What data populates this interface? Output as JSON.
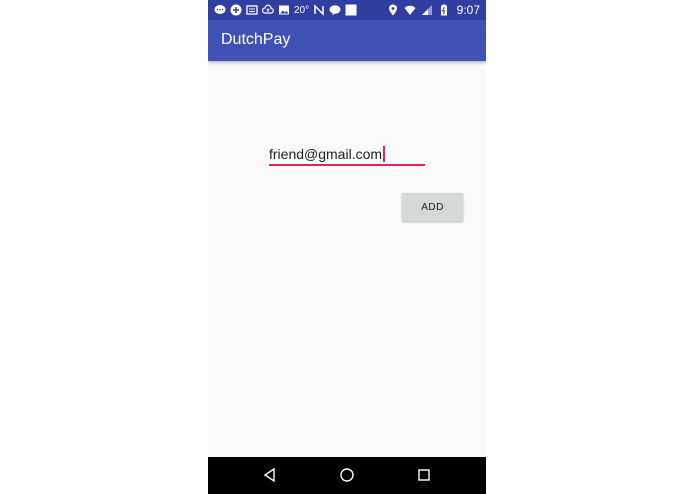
{
  "status_bar": {
    "temperature": "20°",
    "time": "9:07",
    "background": "#303f9f",
    "icons_left": [
      "chat-icon",
      "puzzle-icon",
      "news-icon",
      "cloud-upload-icon",
      "image-icon",
      "weather-text",
      "nfc-icon",
      "sms-icon",
      "square-app-icon"
    ],
    "icons_right": [
      "location-icon",
      "wifi-icon",
      "cell-signal-icon",
      "battery-charging-icon"
    ]
  },
  "app_bar": {
    "title": "DutchPay",
    "color": "#3f51b5"
  },
  "form": {
    "email_value": "friend@gmail.com",
    "accent_color": "#e91e63",
    "add_label": "ADD"
  },
  "nav_bar": {
    "buttons": [
      "back-icon",
      "home-icon",
      "recents-icon"
    ]
  }
}
